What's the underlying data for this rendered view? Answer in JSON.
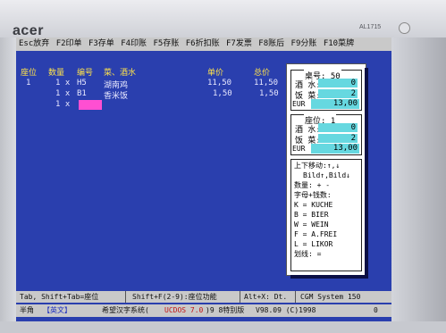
{
  "bezel": {
    "brand": "acer",
    "model": "AL1715"
  },
  "menu": [
    "Esc放弃",
    "F2印单",
    "F3存单",
    "F4印账",
    "F5存账",
    "F6折扣账",
    "F7发票",
    "F8账后",
    "F9分账",
    "F10菜牌"
  ],
  "order": {
    "headers": {
      "seat": "座位",
      "qty": "数量",
      "code": "编号",
      "dish": "菜、酒水",
      "unit_price": "单价",
      "total_price": "总价"
    },
    "seat_no": "1",
    "rows": [
      {
        "qty": "1 x",
        "code": "H5",
        "dish": "湖南鸡",
        "unit_price": "11,50",
        "total_price": "11,50"
      },
      {
        "qty": "1 x",
        "code": "B1",
        "dish": "香米饭",
        "unit_price": "1,50",
        "total_price": "1,50"
      },
      {
        "qty": "1 x",
        "code": "",
        "dish": "",
        "unit_price": "",
        "total_price": ""
      }
    ]
  },
  "side_panel": {
    "table_box": {
      "title": "桌号: 50",
      "drinks_label": "酒 水:",
      "drinks_value": "0",
      "food_label": "饭 菜:",
      "food_value": "2",
      "eur_label": "EUR",
      "eur_value": "13,00"
    },
    "seat_box": {
      "title": "座位: 1",
      "drinks_label": "酒 水:",
      "drinks_value": "0",
      "food_label": "饭 菜:",
      "food_value": "2",
      "eur_label": "EUR",
      "eur_value": "13,00"
    },
    "help": [
      "上下移动:↑,↓",
      "Bild↑,Bild↓",
      "数量: + -",
      "字母+钱数:",
      "K = KUCHE",
      "B = BIER",
      "W = WEIN",
      "F = A.FREI",
      "L = LIKOR",
      "划线: ="
    ]
  },
  "status": {
    "tab_hint": "Tab, Shift+Tab=座位",
    "shift_hint": "Shift+F(2-9):座位功能",
    "alt_hint": "Alt+X: Dt.",
    "system": "CGM System 150"
  },
  "ime": {
    "mode": "半角",
    "lang": "【英文】",
    "sys_name": "希望汉字系统(",
    "ucdos": "UCDOS 7.0",
    "edition": ")9 8特别版",
    "version": "V98.09 (C)1998",
    "num": "0"
  }
}
